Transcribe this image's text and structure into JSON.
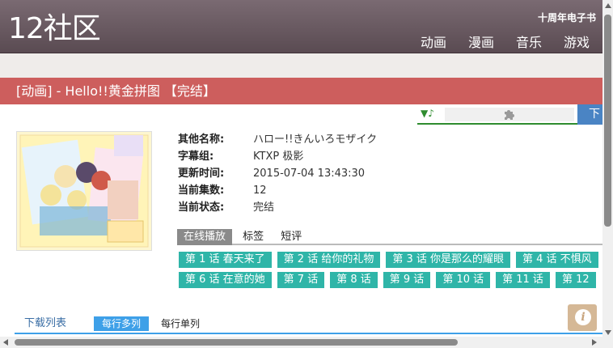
{
  "header": {
    "logo": "12社区",
    "anniversary": "十周年电子书",
    "nav": [
      "动画",
      "漫画",
      "音乐",
      "游戏"
    ]
  },
  "title": "[动画] - Hello!!黄金拼图 【完结】",
  "player": {
    "music_icon": "▼♪",
    "puzzle_icon": "puzzle-icon",
    "download_label": "下"
  },
  "info": {
    "rows": [
      {
        "label": "其他名称:",
        "value": "ハロー!!きんいろモザイク"
      },
      {
        "label": "字幕组:",
        "value": "KTXP 极影"
      },
      {
        "label": "更新时间:",
        "value": "2015-07-04 13:43:30"
      },
      {
        "label": "当前集数:",
        "value": "12"
      },
      {
        "label": "当前状态:",
        "value": "完结"
      }
    ]
  },
  "tabs": [
    "在线播放",
    "标签",
    "短评"
  ],
  "episodes": {
    "row1": [
      "第 1 话 春天来了",
      "第 2 话 给你的礼物",
      "第 3 话 你是那么的耀眼",
      "第 4 话 不惧风"
    ],
    "row2": [
      "第 6 话 在意的她",
      "第 7 话",
      "第 8 话",
      "第 9 话",
      "第 10 话",
      "第 11 话",
      "第 12"
    ]
  },
  "download": {
    "label": "下载列表",
    "tab_multi": "每行多列",
    "tab_single": "每行单列"
  },
  "info_fab": "i",
  "colors": {
    "header": "#6b5b63",
    "titlebar": "#cd5e5d",
    "episode": "#2fb5a8",
    "tab_active": "#3ea0e8",
    "player_download": "#4a84c4"
  }
}
